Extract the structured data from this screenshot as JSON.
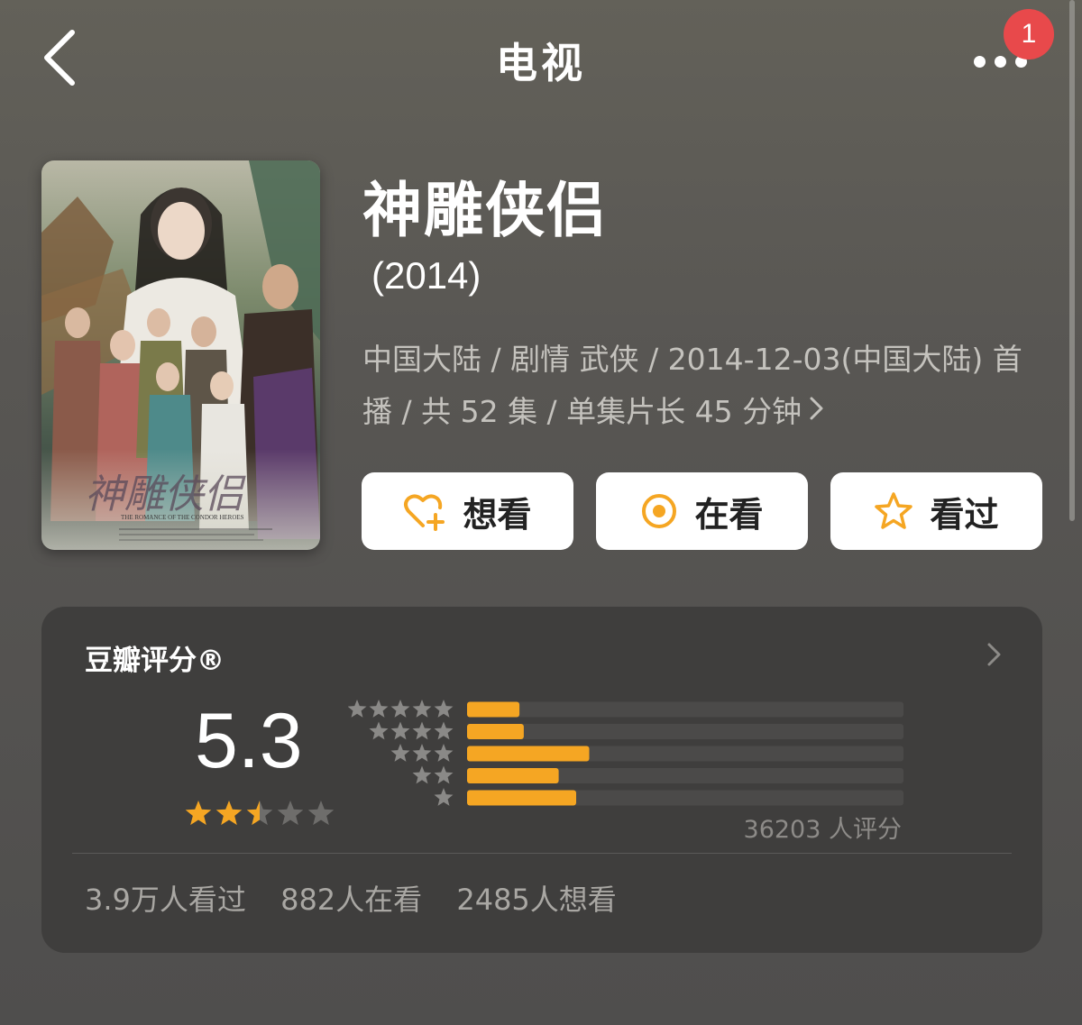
{
  "header": {
    "title": "电视",
    "notification_count": "1",
    "back_icon": "chevron-left-icon",
    "more_icon": "more-dots-icon"
  },
  "poster": {
    "title_cn": "神雕侠侣",
    "title_en": "THE ROMANCE OF THE CONDOR HEROES"
  },
  "show": {
    "title": "神雕侠侣",
    "year": "(2014)",
    "meta": "中国大陆 / 剧情 武侠 / 2014-12-03(中国大陆) 首播 / 共 52 集 / 单集片长 45 分钟"
  },
  "actions": [
    {
      "label": "想看",
      "icon": "heart-plus-icon"
    },
    {
      "label": "在看",
      "icon": "target-icon"
    },
    {
      "label": "看过",
      "icon": "star-outline-icon"
    }
  ],
  "rating": {
    "title": "豆瓣评分®",
    "score": "5.3",
    "stars": 2.5,
    "total": "36203 人评分",
    "distribution": [
      {
        "stars": 5,
        "fraction": 0.12
      },
      {
        "stars": 4,
        "fraction": 0.13
      },
      {
        "stars": 3,
        "fraction": 0.28
      },
      {
        "stars": 2,
        "fraction": 0.21
      },
      {
        "stars": 1,
        "fraction": 0.25
      }
    ]
  },
  "stats": {
    "watched": "3.9万人看过",
    "watching": "882人在看",
    "want": "2485人想看"
  },
  "colors": {
    "accent": "#f5a623",
    "badge": "#e8494b",
    "card_bg": "#3f3e3d",
    "track": "#4b4a49"
  }
}
